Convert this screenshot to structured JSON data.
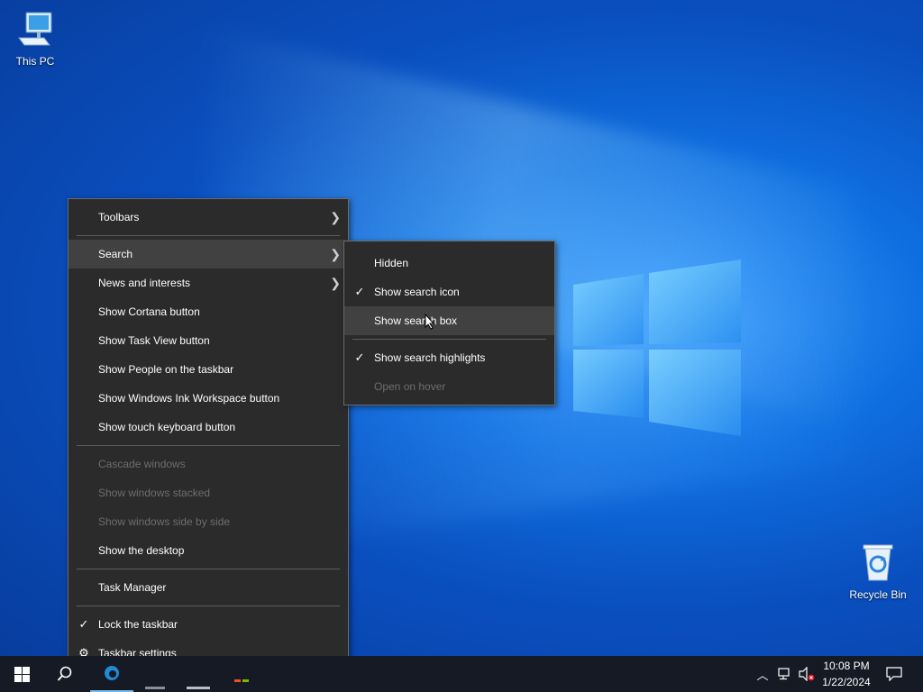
{
  "desktop": {
    "icons": [
      {
        "label": "This PC",
        "icon": "computer-icon"
      },
      {
        "label": "Recycle Bin",
        "icon": "recycle-bin-icon"
      }
    ]
  },
  "context_menu": {
    "items": [
      {
        "label": "Toolbars",
        "submenu": true,
        "enabled": true
      },
      {
        "label": "Search",
        "submenu": true,
        "enabled": true,
        "highlighted": true
      },
      {
        "label": "News and interests",
        "submenu": true,
        "enabled": true
      },
      {
        "label": "Show Cortana button",
        "enabled": true
      },
      {
        "label": "Show Task View button",
        "enabled": true
      },
      {
        "label": "Show People on the taskbar",
        "enabled": true
      },
      {
        "label": "Show Windows Ink Workspace button",
        "enabled": true
      },
      {
        "label": "Show touch keyboard button",
        "enabled": true
      },
      {
        "label": "Cascade windows",
        "enabled": false
      },
      {
        "label": "Show windows stacked",
        "enabled": false
      },
      {
        "label": "Show windows side by side",
        "enabled": false
      },
      {
        "label": "Show the desktop",
        "enabled": true
      },
      {
        "label": "Task Manager",
        "enabled": true
      },
      {
        "label": "Lock the taskbar",
        "enabled": true,
        "checked": true
      },
      {
        "label": "Taskbar settings",
        "enabled": true,
        "icon": "gear-icon"
      }
    ]
  },
  "search_submenu": {
    "items": [
      {
        "label": "Hidden",
        "enabled": true
      },
      {
        "label": "Show search icon",
        "enabled": true,
        "checked": true
      },
      {
        "label": "Show search box",
        "enabled": true,
        "highlighted": true
      },
      {
        "label": "Show search highlights",
        "enabled": true,
        "checked": true
      },
      {
        "label": "Open on hover",
        "enabled": false
      }
    ]
  },
  "taskbar": {
    "start_icon": "windows-logo-icon",
    "search_icon": "search-icon",
    "clock": {
      "time": "10:08 PM",
      "date": "1/22/2024"
    },
    "tray_icons": [
      "chevron-up-icon",
      "network-icon",
      "volume-muted-icon",
      "notification-icon"
    ]
  },
  "colors": {
    "menu_bg": "#2b2b2b",
    "menu_hover": "#414141",
    "taskbar_bg": "#151a24",
    "accent": "#76b9ed"
  }
}
